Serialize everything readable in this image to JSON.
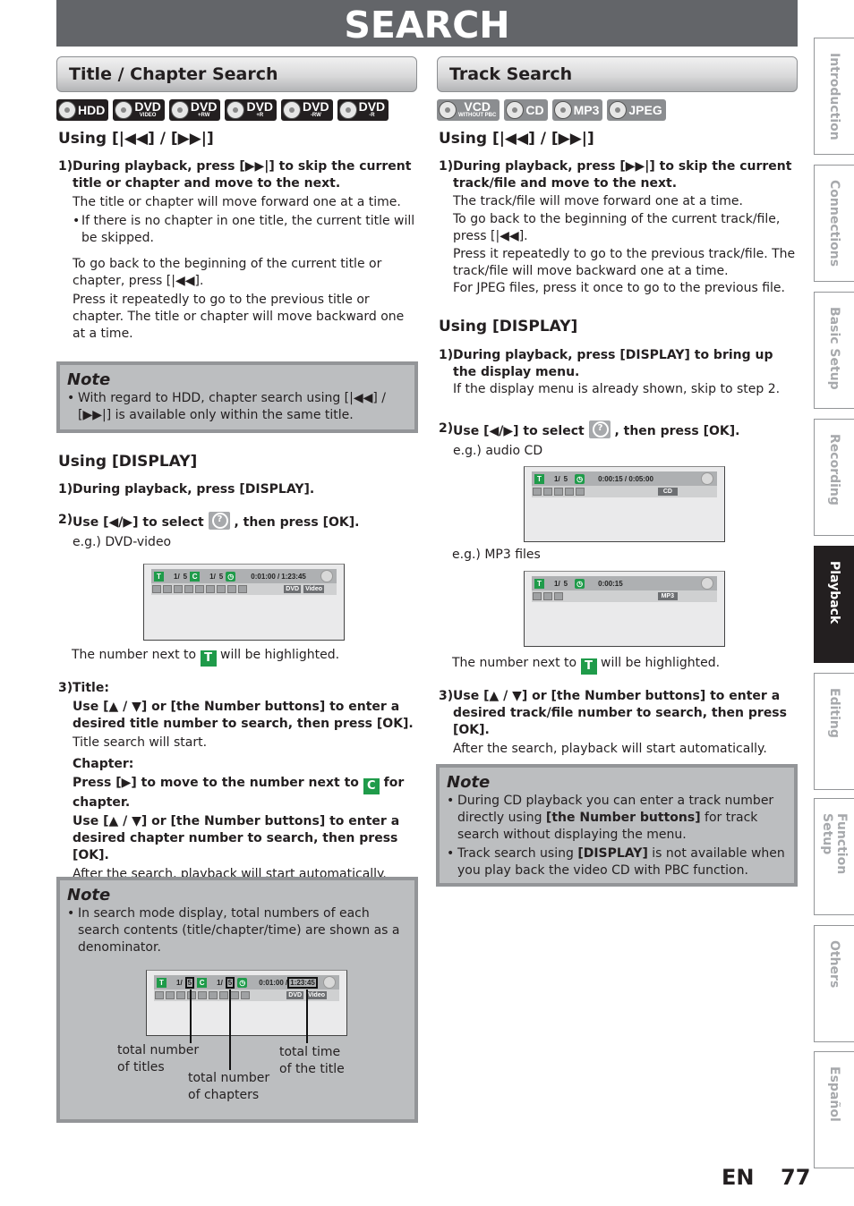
{
  "page": {
    "title": "SEARCH",
    "language": "EN",
    "page_number": "77"
  },
  "left": {
    "header": "Title / Chapter Search",
    "badges": [
      {
        "main": "HDD",
        "sub": ""
      },
      {
        "main": "DVD",
        "sub": "VIDEO"
      },
      {
        "main": "DVD",
        "sub": "+RW"
      },
      {
        "main": "DVD",
        "sub": "+R"
      },
      {
        "main": "DVD",
        "sub": "-RW"
      },
      {
        "main": "DVD",
        "sub": "-R"
      }
    ],
    "skip": {
      "heading": "Using [|◀◀] / [▶▶|]",
      "step1_num": "1)",
      "step1_bold": "During playback, press [▶▶|] to skip the current title or chapter and move to the next.",
      "step1_text": "The title or chapter will move forward one at a time.",
      "step1_bullet": "If there is no chapter in one title, the current title will be skipped.",
      "back_text": "To go back to the beginning of the current title or chapter, press [|◀◀].",
      "repeat_text": "Press it repeatedly to go to the previous title or chapter. The title or chapter will move backward one at a time."
    },
    "note1": {
      "title": "Note",
      "bullet": "With regard to HDD, chapter search using [|◀◀] / [▶▶|] is available only within the same title."
    },
    "display": {
      "heading": "Using [DISPLAY]",
      "step1_num": "1)",
      "step1_bold": "During playback, press [DISPLAY].",
      "step2_num": "2)",
      "step2_pre": "Use [◀/▶] to select",
      "step2_post": ", then press [OK].",
      "example": "e.g.) DVD-video",
      "osd": {
        "t_icon": "T",
        "title_pos": "1/",
        "title_total": "5",
        "c_icon": "C",
        "chapter_pos": "1/",
        "chapter_total": "5",
        "time_elapsed": "0:01:00 /",
        "time_total": "1:23:45",
        "tag1": "DVD",
        "tag2": "Video"
      },
      "highlight_pre": "The number next to",
      "highlight_icon": "T",
      "highlight_post": "will be highlighted.",
      "step3_num": "3)",
      "step3_title_label": "Title:",
      "step3_title_bold": "Use [▲ / ▼] or [the Number buttons] to enter a desired title number to search, then press [OK].",
      "step3_title_text": "Title search will start.",
      "step3_chapter_label": "Chapter:",
      "step3_chapter_press_pre": "Press [▶] to move to the number next to",
      "step3_chapter_icon": "C",
      "step3_chapter_press_post": "for chapter.",
      "step3_chapter_bold": "Use [▲ / ▼] or [the Number buttons] to enter a desired chapter number to search, then press [OK].",
      "step3_chapter_text": "After the search, playback will start automatically."
    },
    "note2": {
      "title": "Note",
      "bullet": "In search mode display, total numbers of each search contents (title/chapter/time) are shown as a denominator.",
      "callout_titles": "total number of titles",
      "callout_chapters": "total number of chapters",
      "callout_time": "total time of the title"
    }
  },
  "right": {
    "header": "Track Search",
    "badges": [
      {
        "main": "VCD",
        "sub": "WITHOUT PBC"
      },
      {
        "main": "CD",
        "sub": ""
      },
      {
        "main": "MP3",
        "sub": ""
      },
      {
        "main": "JPEG",
        "sub": ""
      }
    ],
    "skip": {
      "heading": "Using [|◀◀] / [▶▶|]",
      "step1_num": "1)",
      "step1_bold": "During playback, press [▶▶|] to skip the current track/file and move to the next.",
      "line1": "The track/file will move forward one at a time.",
      "line2": "To go back to the beginning of the current track/file, press [|◀◀].",
      "line3": "Press it repeatedly to go to the previous track/file. The track/file will move backward one at a time.",
      "line4": "For JPEG files, press it once to go to the previous file."
    },
    "display": {
      "heading": "Using [DISPLAY]",
      "step1_num": "1)",
      "step1_bold": "During playback, press [DISPLAY] to bring up the display menu.",
      "step1_text": "If the display menu is already shown, skip to step 2.",
      "step2_num": "2)",
      "step2_pre": "Use [◀/▶] to select",
      "step2_post": ", then press [OK].",
      "example_cd": "e.g.) audio CD",
      "osd_cd": {
        "t_icon": "T",
        "pos": "1/",
        "total": "5",
        "time": "0:00:15 / 0:05:00",
        "tag": "CD"
      },
      "example_mp3": "e.g.) MP3 files",
      "osd_mp3": {
        "t_icon": "T",
        "pos": "1/",
        "total": "5",
        "time": "0:00:15",
        "tag": "MP3"
      },
      "highlight_pre": "The number next to",
      "highlight_icon": "T",
      "highlight_post": "will be highlighted.",
      "step3_num": "3)",
      "step3_bold": "Use [▲ / ▼] or [the Number buttons] to enter a desired track/file number to search, then press [OK].",
      "step3_text": "After the search, playback will start automatically."
    },
    "note": {
      "title": "Note",
      "bullet1_pre": "During CD playback you can enter a track number directly using ",
      "bullet1_bold": "[the Number buttons]",
      "bullet1_post": " for track search without displaying the menu.",
      "bullet2_pre": "Track search using ",
      "bullet2_bold": "[DISPLAY]",
      "bullet2_post": " is not available when you play back the video CD with PBC function."
    }
  },
  "side_tabs": [
    {
      "label": "Introduction",
      "active": false
    },
    {
      "label": "Connections",
      "active": false
    },
    {
      "label": "Basic Setup",
      "active": false
    },
    {
      "label": "Recording",
      "active": false
    },
    {
      "label": "Playback",
      "active": true
    },
    {
      "label": "Editing",
      "active": false
    },
    {
      "label": "Function Setup",
      "active": false
    },
    {
      "label": "Others",
      "active": false
    },
    {
      "label": "Español",
      "active": false
    }
  ]
}
